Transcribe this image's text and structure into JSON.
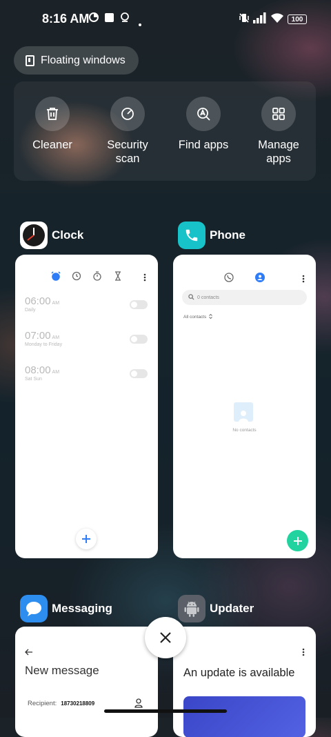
{
  "status_bar": {
    "time": "8:16 AM",
    "battery": "100"
  },
  "floating_windows": {
    "label": "Floating windows"
  },
  "quick_actions": [
    {
      "label": "Cleaner",
      "icon": "trash-icon"
    },
    {
      "label": "Security scan",
      "icon": "security-scan-icon"
    },
    {
      "label": "Find apps",
      "icon": "find-apps-icon"
    },
    {
      "label": "Manage apps",
      "icon": "grid-icon"
    }
  ],
  "apps": {
    "clock": {
      "name": "Clock",
      "alarms": [
        {
          "time": "06:00",
          "ampm": "AM",
          "sub": "Daily"
        },
        {
          "time": "07:00",
          "ampm": "AM",
          "sub": "Monday to Friday"
        },
        {
          "time": "08:00",
          "ampm": "AM",
          "sub": "Sat Sun"
        }
      ]
    },
    "phone": {
      "name": "Phone",
      "search_placeholder": "0 contacts",
      "filter": "All contacts",
      "empty_text": "No contacts"
    },
    "messaging": {
      "name": "Messaging",
      "title": "New message",
      "recipient_label": "Recipient:",
      "recipient_value": "18730218809"
    },
    "updater": {
      "name": "Updater",
      "title": "An update is available"
    }
  },
  "colors": {
    "accent_blue": "#2f7df6",
    "phone_green": "#22d3a0",
    "phone_icon_teal": "#17c3c9",
    "messaging_blue": "#2d8ef0"
  }
}
